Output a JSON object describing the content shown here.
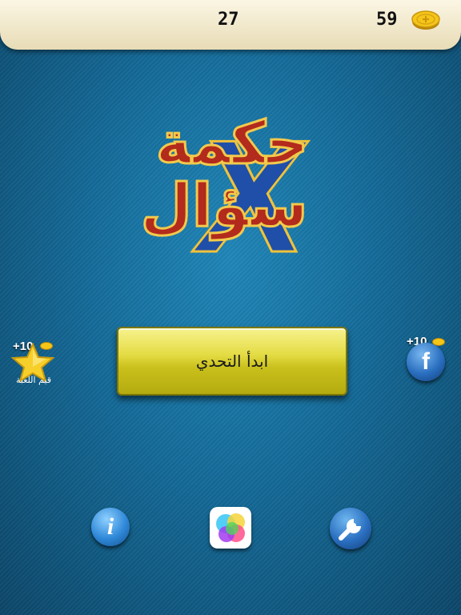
{
  "header": {
    "score": "27",
    "coins": "59"
  },
  "logo": {
    "line1": "حكمة",
    "line2": "سؤال",
    "mark": "X"
  },
  "play_button": {
    "label": "ابدأ التحدي"
  },
  "rate": {
    "bonus": "+10",
    "caption": "قيم اللعبة"
  },
  "facebook": {
    "bonus": "+10",
    "glyph": "f"
  },
  "info_button": {
    "glyph": "i"
  },
  "icons": {
    "coin": "coin-icon",
    "star": "star-icon",
    "facebook": "facebook-icon",
    "info": "info-icon",
    "game_center": "game-center-icon",
    "settings": "wrench-icon"
  },
  "colors": {
    "logo_red": "#b22b1c",
    "logo_blue": "#1f4fa8",
    "button_yellow": "#e4dc44"
  }
}
